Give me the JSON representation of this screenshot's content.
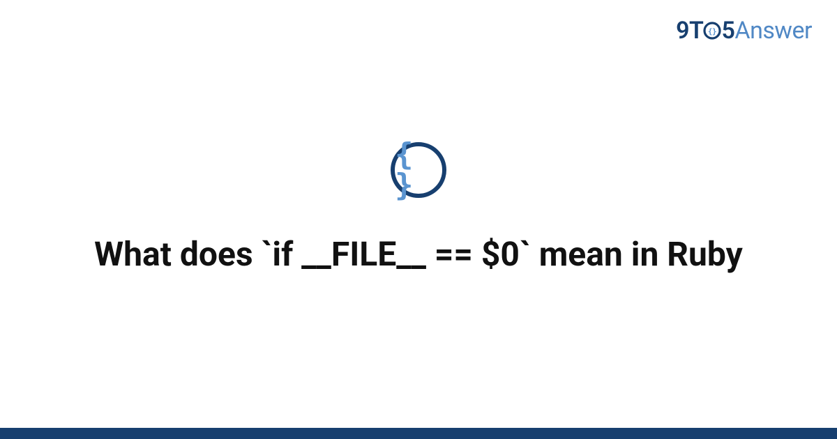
{
  "logo": {
    "part1": "9T",
    "part2": "5",
    "part3": "Answer"
  },
  "icon": {
    "name": "braces-icon",
    "glyph": "{ }"
  },
  "title": "What does `if __FILE__ == $0` mean in Ruby",
  "colors": {
    "primary": "#173f6f",
    "accent": "#5088c5",
    "background": "#ffffff"
  }
}
